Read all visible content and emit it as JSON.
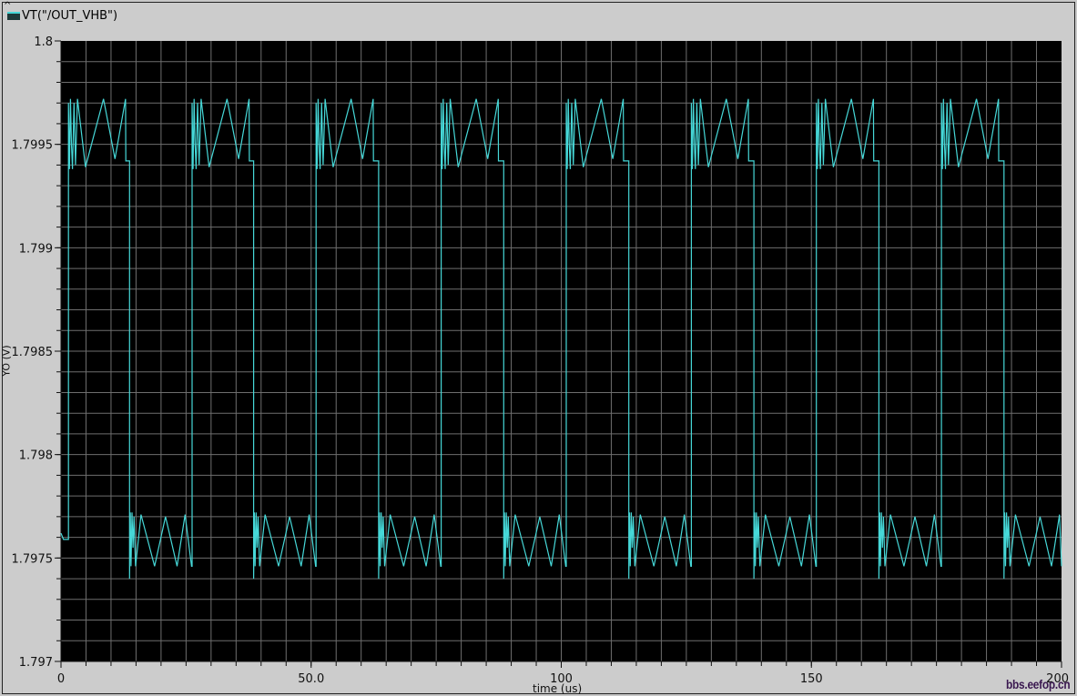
{
  "chart_data": {
    "type": "line",
    "title": "",
    "legend": [
      "VT(\"/OUT_VHB\")"
    ],
    "legend_placement": "top-left",
    "xlabel": "time (us)",
    "ylabel": "YO (V)",
    "xlim": [
      0,
      200
    ],
    "ylim": [
      1.797,
      1.8
    ],
    "xticks": [
      0,
      50,
      100,
      150,
      200
    ],
    "xtick_labels": [
      "0",
      "50.0",
      "100",
      "150",
      "200"
    ],
    "yticks": [
      1.8,
      1.7995,
      1.799,
      1.7985,
      1.798,
      1.7975,
      1.797
    ],
    "ytick_labels": [
      "1.8",
      "1.7995",
      "1.799",
      "1.7985",
      "1.798",
      "1.7975",
      "1.797"
    ],
    "grid": true,
    "grid_x_step": 5,
    "grid_y_step": 0.0001,
    "series": [
      {
        "name": "VT(\"/OUT_VHB\")",
        "color": "#46d8d8",
        "initial": [
          [
            0,
            1.79762
          ],
          [
            0.5,
            1.79759
          ],
          [
            1.3,
            1.79759
          ]
        ],
        "rising_edges": [
          1.5,
          26.2,
          51,
          76,
          101,
          126,
          151,
          176
        ],
        "falling_edges": [
          13.7,
          38.5,
          63.5,
          88.5,
          113.5,
          138.5,
          163.5,
          188.5
        ],
        "end_time": 200,
        "high_pattern": [
          [
            0,
            1.7997
          ],
          [
            0.2,
            1.79938
          ],
          [
            0.4,
            1.79972
          ],
          [
            0.6,
            1.7995
          ],
          [
            0.8,
            1.79938
          ],
          [
            1.1,
            1.7997
          ],
          [
            1.4,
            1.7994
          ],
          [
            1.8,
            1.79972
          ],
          [
            3.4,
            1.79939
          ],
          [
            7.0,
            1.79972
          ],
          [
            9.3,
            1.79943
          ],
          [
            11.4,
            1.79972
          ],
          [
            11.45,
            1.79942
          ]
        ],
        "low_pattern": [
          [
            0,
            1.7974
          ],
          [
            0.15,
            1.79772
          ],
          [
            0.3,
            1.79746
          ],
          [
            0.5,
            1.79772
          ],
          [
            0.7,
            1.79755
          ],
          [
            0.9,
            1.7977
          ],
          [
            1.2,
            1.79746
          ],
          [
            2.3,
            1.79771
          ],
          [
            5.0,
            1.79746
          ],
          [
            7.2,
            1.7977
          ],
          [
            9.5,
            1.79746
          ],
          [
            11.1,
            1.79771
          ],
          [
            12.4,
            1.79746
          ]
        ]
      }
    ]
  },
  "watermark": "bbs.eefop.cn"
}
